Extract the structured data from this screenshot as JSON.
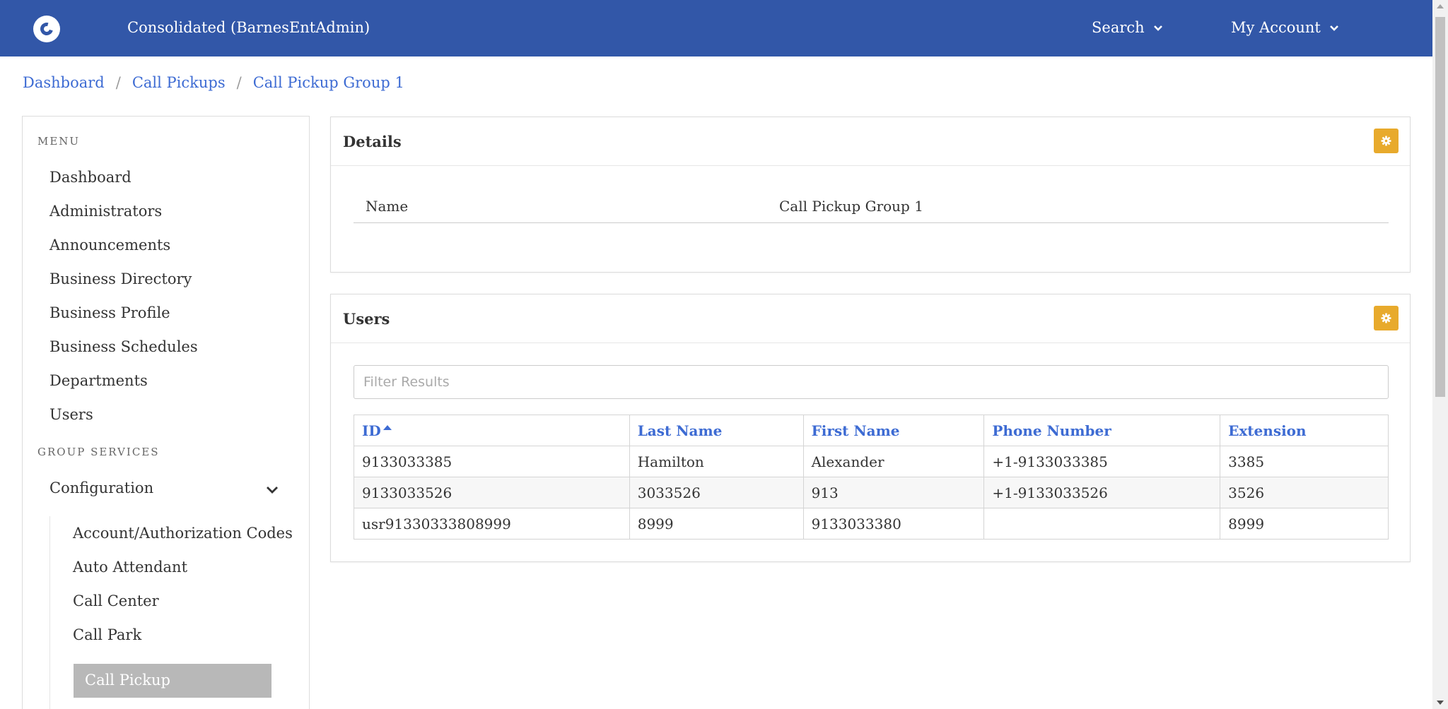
{
  "header": {
    "title": "Consolidated (BarnesEntAdmin)",
    "search_label": "Search",
    "account_label": "My Account",
    "bg_color": "#3257a8"
  },
  "breadcrumb": [
    "Dashboard",
    "Call Pickups",
    "Call Pickup Group 1"
  ],
  "sidebar": {
    "menu_heading": "MENU",
    "items": [
      "Dashboard",
      "Administrators",
      "Announcements",
      "Business Directory",
      "Business Profile",
      "Business Schedules",
      "Departments",
      "Users"
    ],
    "group_heading": "GROUP SERVICES",
    "configuration_label": "Configuration",
    "sub_items": [
      "Account/Authorization Codes",
      "Auto Attendant",
      "Call Center",
      "Call Park"
    ],
    "active_item": "Call Pickup"
  },
  "details": {
    "title": "Details",
    "name_label": "Name",
    "name_value": "Call Pickup Group 1"
  },
  "users": {
    "title": "Users",
    "filter_placeholder": "Filter Results",
    "columns": [
      "ID",
      "Last Name",
      "First Name",
      "Phone Number",
      "Extension"
    ],
    "sort_column": "ID",
    "sort_direction": "ascending",
    "rows": [
      [
        "9133033385",
        "Hamilton",
        "Alexander",
        "+1-9133033385",
        "3385"
      ],
      [
        "9133033526",
        "3033526",
        "913",
        "+1-9133033526",
        "3526"
      ],
      [
        "usr91330333808999",
        "8999",
        "9133033380",
        "",
        "8999"
      ]
    ]
  },
  "colors": {
    "accent": "#3d6bd3",
    "gear_button": "#e8aa2c",
    "active_item_bg": "#b8b8b8"
  }
}
